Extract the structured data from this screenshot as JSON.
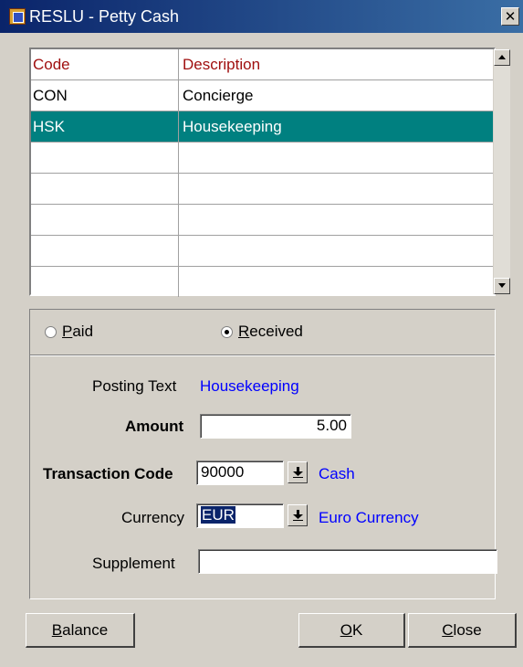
{
  "window": {
    "title": "RESLU - Petty Cash",
    "close_glyph": "✕"
  },
  "grid": {
    "columns": [
      "Code",
      "Description"
    ],
    "rows": [
      {
        "code": "CON",
        "description": "Concierge",
        "selected": false
      },
      {
        "code": "HSK",
        "description": "Housekeeping",
        "selected": true
      }
    ],
    "empty_row_count": 5
  },
  "radios": {
    "paid": {
      "mnemonic": "P",
      "rest": "aid",
      "checked": false
    },
    "received": {
      "mnemonic": "R",
      "rest": "eceived",
      "checked": true
    }
  },
  "form": {
    "posting_text_label": "Posting Text",
    "posting_text_value": "Housekeeping",
    "amount_label": "Amount",
    "amount_value": "5.00",
    "transaction_code_label": "Transaction Code",
    "transaction_code_value": "90000",
    "transaction_code_desc": "Cash",
    "currency_label": "Currency",
    "currency_value": "EUR",
    "currency_desc": "Euro Currency",
    "supplement_label": "Supplement",
    "supplement_value": ""
  },
  "buttons": {
    "balance": {
      "mnemonic": "B",
      "rest": "alance"
    },
    "ok": {
      "mnemonic": "O",
      "rest": "K"
    },
    "close": {
      "mnemonic": "C",
      "rest": "lose"
    }
  },
  "colors": {
    "title_start": "#0a246a",
    "title_end": "#3a6ea5",
    "selection": "#008080",
    "header_text": "#a01010",
    "link_blue": "#0000ff",
    "face": "#d4d0c8"
  },
  "icons": {
    "window": "app-window-icon",
    "close": "close-icon",
    "scroll_up": "scroll-up-arrow-icon",
    "scroll_down": "scroll-down-arrow-icon",
    "dropdown": "dropdown-arrow-icon"
  }
}
